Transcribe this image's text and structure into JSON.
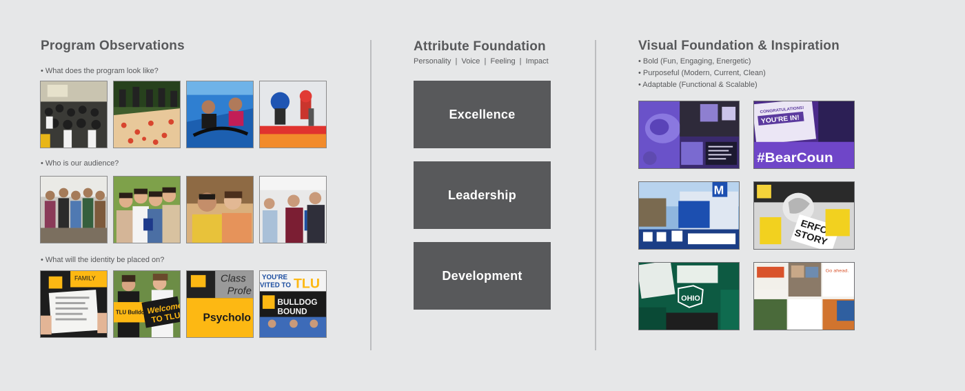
{
  "program": {
    "title": "Program Observations",
    "q1": "• What does the program look like?",
    "q2": "• Who is our audience?",
    "q3": "• What will the identity be placed on?",
    "identity_text": {
      "family": "FAMILY",
      "bulldogs": "TLU Bulldogs",
      "welcome_1": "Welcome",
      "welcome_2": "TO TLU",
      "class_1": "Class",
      "class_2": "Profe",
      "psych": "Psycholo",
      "youre_1": "YOU'RE",
      "youre_2": "VITED TO",
      "tlu": "TLU",
      "bulldog": "BULLDOG",
      "bound": "BOUND"
    }
  },
  "attribute": {
    "title": "Attribute Foundation",
    "subtitle": "Personality  |  Voice  |  Feeling  |  Impact",
    "boxes": [
      "Excellence",
      "Leadership",
      "Development"
    ]
  },
  "visual": {
    "title": "Visual Foundation & Inspiration",
    "bullets": [
      "• Bold (Fun, Engaging, Energetic)",
      "• Purposeful (Modern, Current, Clean)",
      "• Adaptable (Functional & Scalable)"
    ],
    "inspo_text": {
      "youre_in": "YOU'RE IN!",
      "congrats": "CONGRATULATIONS!",
      "hashtag": "#BearCoun",
      "m": "M",
      "erfo": "ERFO",
      "story": "STORY",
      "ohio": "OHIO",
      "ahead": "Go ahead."
    }
  },
  "colors": {
    "background": "#e6e7e8",
    "text": "#58595b",
    "box": "#58595b",
    "gold": "#fdb813",
    "purple": "#5b3a9e",
    "green": "#0f6b4f"
  }
}
